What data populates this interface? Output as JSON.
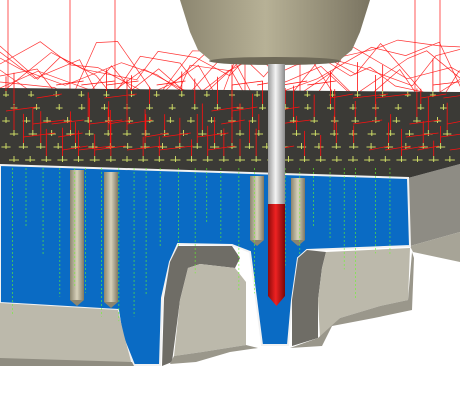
{
  "scene": {
    "kind": "cnc-drilling-toolpath-simulation",
    "colors": {
      "background": "#ffffff",
      "part_section": "#0a6bc4",
      "part_top": "#3b3a36",
      "part_side": "#8e8c84",
      "part_face_light": "#bcb9ab",
      "part_face_dark": "#6f6d66",
      "holder": "#a9a38a",
      "holder_dark": "#7c7663",
      "tool_shank": "#d8d8d8",
      "tool_tip": "#d21414",
      "toolpath": "#ff1010",
      "toolpath_plunge": "#66ff22",
      "hole_marker": "#d9e86a",
      "drilled_hole": "#b8b09a"
    },
    "toolpath_visible": true,
    "cross_section_visible": true
  }
}
